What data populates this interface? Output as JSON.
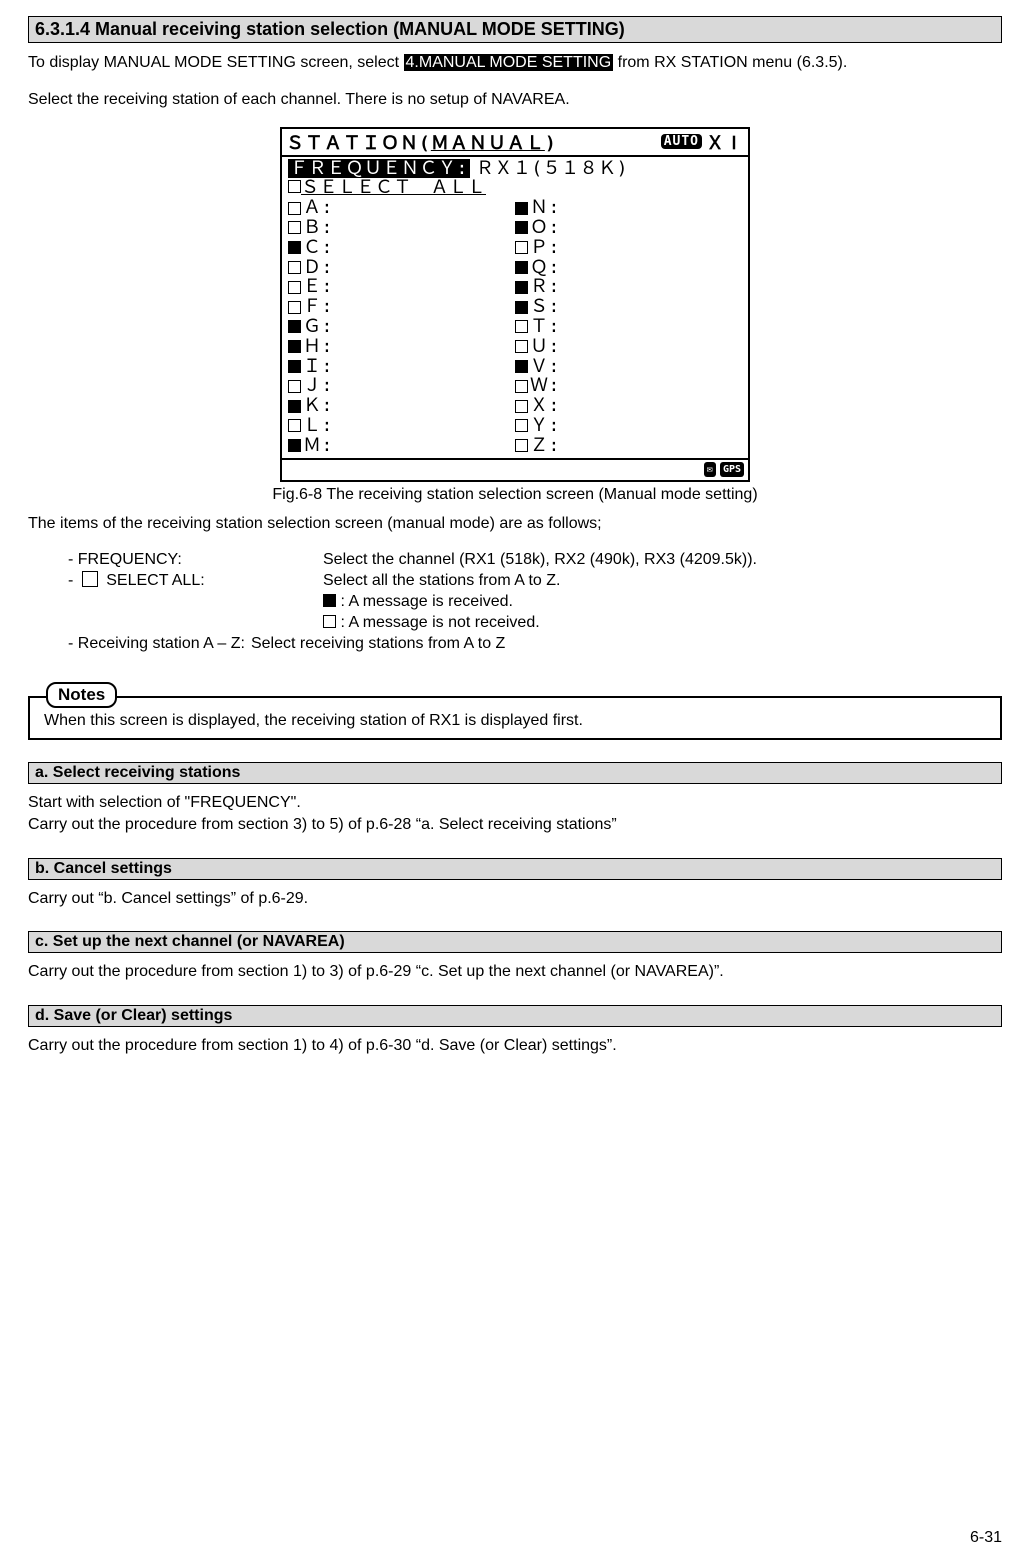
{
  "section": {
    "title": "6.3.1.4 Manual receiving station selection (MANUAL MODE SETTING)"
  },
  "intro": {
    "part1": "To display MANUAL MODE SETTING screen, select ",
    "highlight": "4.MANUAL MODE SETTING",
    "part2": " from RX STATION menu (6.3.5).",
    "para2": "Select the receiving station of each channel. There is no setup of NAVAREA."
  },
  "screen": {
    "title": {
      "prefix": "ＳＴＡＴＩＯＮ(",
      "underlined": "ＭＡＮＵＡＬ",
      "suffix": ")",
      "auto": "AUTO",
      "navarea": "ＸⅠ"
    },
    "frequency": {
      "label": "ＦＲＥＱＵＥＮＣＹ:",
      "value": "ＲＸ１(５１８Ｋ)"
    },
    "select_all": "ＳＥＬＥＣＴ　ＡＬＬ",
    "stations_left": [
      {
        "letter": "Ａ",
        "checked": false
      },
      {
        "letter": "Ｂ",
        "checked": false
      },
      {
        "letter": "Ｃ",
        "checked": true
      },
      {
        "letter": "Ｄ",
        "checked": false
      },
      {
        "letter": "Ｅ",
        "checked": false
      },
      {
        "letter": "Ｆ",
        "checked": false
      },
      {
        "letter": "Ｇ",
        "checked": true
      },
      {
        "letter": "Ｈ",
        "checked": true
      },
      {
        "letter": "Ｉ",
        "checked": true
      },
      {
        "letter": "Ｊ",
        "checked": false
      },
      {
        "letter": "Ｋ",
        "checked": true
      },
      {
        "letter": "Ｌ",
        "checked": false
      },
      {
        "letter": "Ｍ",
        "checked": true
      }
    ],
    "stations_right": [
      {
        "letter": "Ｎ",
        "checked": true
      },
      {
        "letter": "Ｏ",
        "checked": true
      },
      {
        "letter": "Ｐ",
        "checked": false
      },
      {
        "letter": "Ｑ",
        "checked": true
      },
      {
        "letter": "Ｒ",
        "checked": true
      },
      {
        "letter": "Ｓ",
        "checked": true
      },
      {
        "letter": "Ｔ",
        "checked": false
      },
      {
        "letter": "Ｕ",
        "checked": false
      },
      {
        "letter": "Ｖ",
        "checked": true
      },
      {
        "letter": "Ｗ",
        "checked": false
      },
      {
        "letter": "Ｘ",
        "checked": false
      },
      {
        "letter": "Ｙ",
        "checked": false
      },
      {
        "letter": "Ｚ",
        "checked": false
      }
    ],
    "footer": {
      "gps": "GPS"
    },
    "caption": "Fig.6-8 The receiving station selection screen (Manual mode setting)"
  },
  "items": {
    "intro": "The items of the receiving station selection screen (manual mode) are as follows;",
    "rows": [
      {
        "label": "- FREQUENCY:",
        "desc": "Select the channel (RX1 (518k), RX2 (490k), RX3 (4209.5k))."
      },
      {
        "label_pre": "- ",
        "label_post": " SELECT ALL:",
        "desc": "Select all the stations from A to Z.",
        "sub1": ": A message is received.",
        "sub2": ": A message is not received."
      },
      {
        "label": "- Receiving station A – Z:",
        "desc": "Select receiving stations from A to Z"
      }
    ]
  },
  "notes": {
    "title": "Notes",
    "body": "When this screen is displayed, the receiving station of RX1 is displayed first."
  },
  "subs": [
    {
      "title": "a. Select receiving stations",
      "body1": "Start with selection of \"FREQUENCY\".",
      "body2": "Carry out the procedure from section 3) to 5) of p.6-28 “a. Select receiving stations”"
    },
    {
      "title": "b. Cancel settings",
      "body1": "Carry out “b. Cancel settings” of p.6-29."
    },
    {
      "title": "c. Set up the next channel (or NAVAREA)",
      "body1": "Carry out the procedure from section 1) to 3) of p.6-29 “c. Set up the next channel (or NAVAREA)”."
    },
    {
      "title": "d. Save (or Clear) settings",
      "body1": "Carry out the procedure from section 1) to 4) of p.6-30 “d. Save (or Clear) settings”."
    }
  ],
  "page_number": "6-31"
}
